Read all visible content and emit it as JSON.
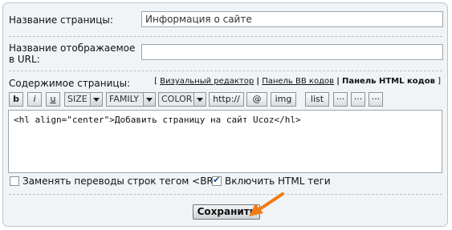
{
  "page_name": {
    "label": "Название страницы:",
    "value": "Информация о сайте"
  },
  "url_name": {
    "label": "Название отображаемое в URL:",
    "value": ""
  },
  "content": {
    "label": "Содержимое страницы:",
    "editor_links": [
      "Визуальный редактор",
      "Панель BB кодов",
      "Панель HTML кодов"
    ],
    "separator": "|",
    "text": "<hl align=\"center\">Добавить страницу на сайт Ucoz</hl>"
  },
  "toolbar": {
    "bold": "b",
    "italic": "i",
    "underline": "u",
    "size": "SIZE",
    "family": "FAMILY",
    "color": "COLOR",
    "http": "http://",
    "at": "@",
    "img": "img",
    "list": "list",
    "more1": "···",
    "more2": "···",
    "more3": "···"
  },
  "options": {
    "replace_br": {
      "label": "Заменять переводы строк тегом <BR>",
      "checked": false
    },
    "enable_html": {
      "label": "Включить HTML теги",
      "checked": true
    }
  },
  "save_label": "Сохранить",
  "colors": {
    "panel_bg": "#f1f4f6",
    "border": "#b9c4cc",
    "arrow": "#f07c14"
  }
}
